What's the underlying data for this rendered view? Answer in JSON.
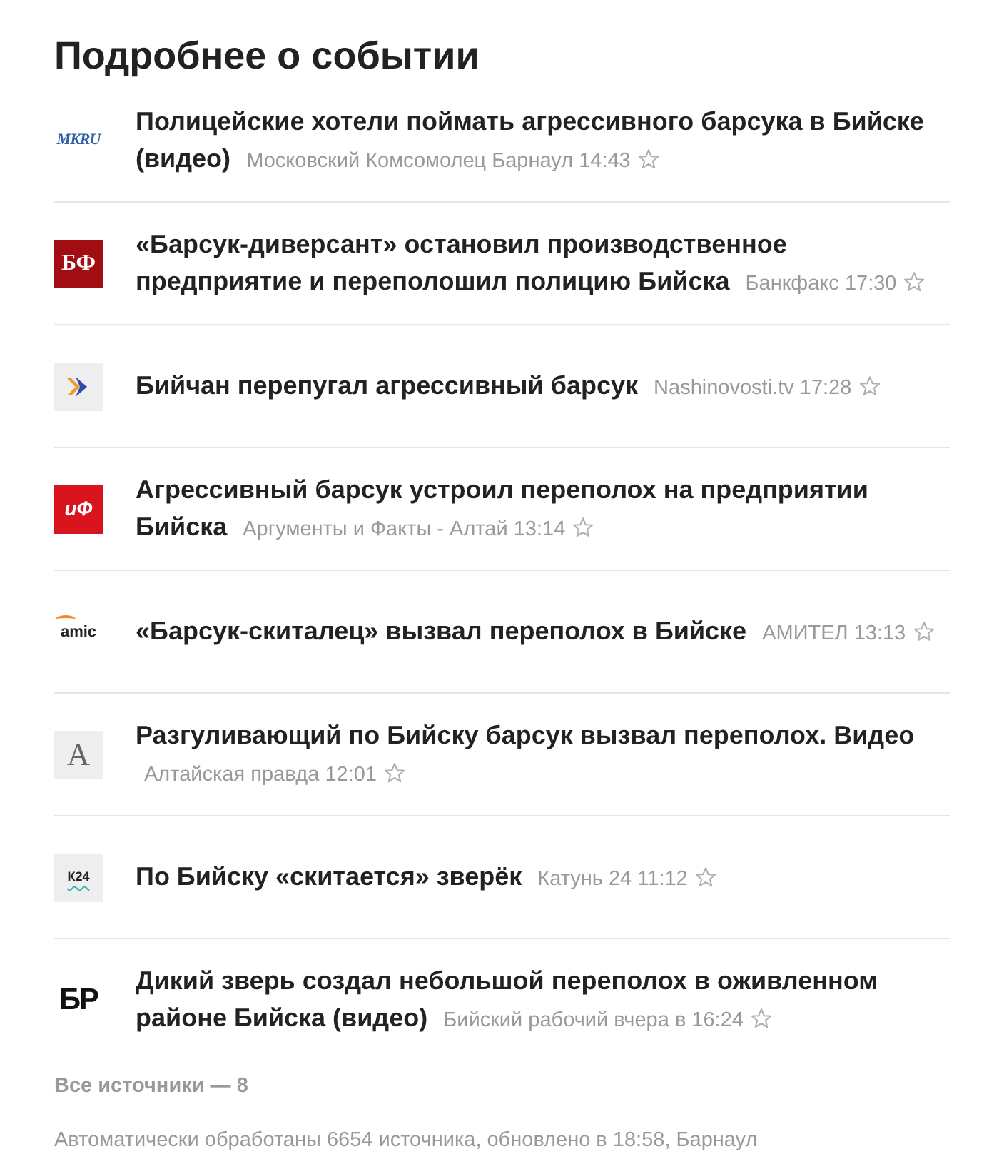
{
  "heading": "Подробнее о событии",
  "news": [
    {
      "logo": {
        "kind": "mkru",
        "text": "MKRU"
      },
      "title": "Полицейские хотели поймать агрессивного барсука в Бийске (видео)",
      "source": "Московский Комсомолец Барнаул",
      "time": "14:43",
      "bookmarked": false
    },
    {
      "logo": {
        "kind": "bf",
        "text": "БФ"
      },
      "title": "«Барсук-диверсант» остановил производственное предприятие и переполошил полицию Бийска",
      "source": "Банкфакс",
      "time": "17:30",
      "bookmarked": false
    },
    {
      "logo": {
        "kind": "arrows"
      },
      "title": "Бийчан перепугал агрессивный барсук",
      "source": "Nashinovosti.tv",
      "time": "17:28",
      "bookmarked": false
    },
    {
      "logo": {
        "kind": "aif",
        "text": "иФ"
      },
      "title": "Агрессивный барсук устроил переполох на предприятии Бийска",
      "source": "Аргументы и Факты - Алтай",
      "time": "13:14",
      "bookmarked": false
    },
    {
      "logo": {
        "kind": "amic",
        "text": "amic"
      },
      "title": "«Барсук-скиталец» вызвал переполох в Бийске",
      "source": "АМИТЕЛ",
      "time": "13:13",
      "bookmarked": false
    },
    {
      "logo": {
        "kind": "letter",
        "text": "А"
      },
      "title": "Разгуливающий по Бийску барсук вызвал переполох. Видео",
      "source": "Алтайская правда",
      "time": "12:01",
      "bookmarked": false
    },
    {
      "logo": {
        "kind": "k24",
        "text": "К24"
      },
      "title": "По Бийску «скитается» зверёк",
      "source": "Катунь 24",
      "time": "11:12",
      "bookmarked": false
    },
    {
      "logo": {
        "kind": "br",
        "text": "БР"
      },
      "title": "Дикий зверь создал небольшой переполох в оживленном районе Бийска (видео)",
      "source": "Бийский рабочий",
      "time": "вчера в 16:24",
      "bookmarked": false
    }
  ],
  "footer": {
    "all_sources": "Все источники — 8",
    "note": "Автоматически обработаны 6654 источника, обновлено в 18:58, Барнаул"
  }
}
